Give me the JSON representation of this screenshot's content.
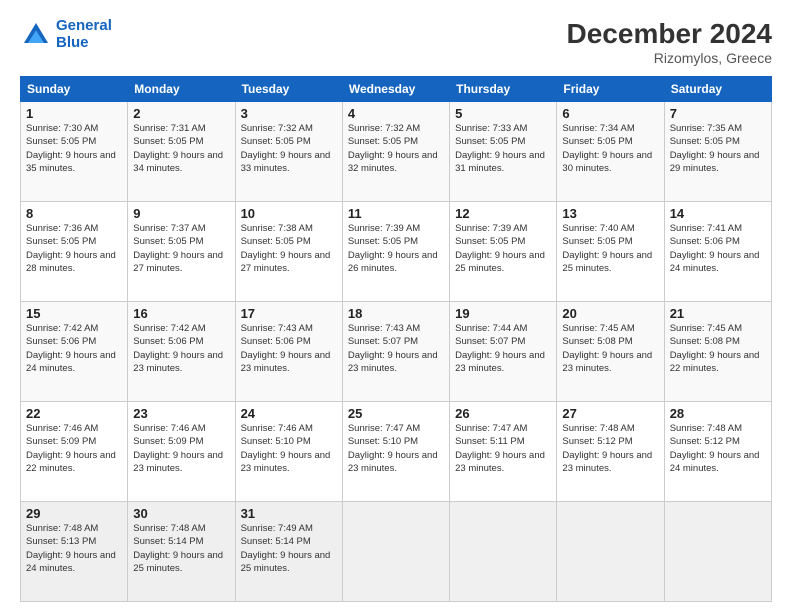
{
  "logo": {
    "line1": "General",
    "line2": "Blue"
  },
  "title": "December 2024",
  "subtitle": "Rizomylos, Greece",
  "weekdays": [
    "Sunday",
    "Monday",
    "Tuesday",
    "Wednesday",
    "Thursday",
    "Friday",
    "Saturday"
  ],
  "weeks": [
    [
      {
        "day": "1",
        "sunrise": "7:30 AM",
        "sunset": "5:05 PM",
        "daylight": "9 hours and 35 minutes."
      },
      {
        "day": "2",
        "sunrise": "7:31 AM",
        "sunset": "5:05 PM",
        "daylight": "9 hours and 34 minutes."
      },
      {
        "day": "3",
        "sunrise": "7:32 AM",
        "sunset": "5:05 PM",
        "daylight": "9 hours and 33 minutes."
      },
      {
        "day": "4",
        "sunrise": "7:32 AM",
        "sunset": "5:05 PM",
        "daylight": "9 hours and 32 minutes."
      },
      {
        "day": "5",
        "sunrise": "7:33 AM",
        "sunset": "5:05 PM",
        "daylight": "9 hours and 31 minutes."
      },
      {
        "day": "6",
        "sunrise": "7:34 AM",
        "sunset": "5:05 PM",
        "daylight": "9 hours and 30 minutes."
      },
      {
        "day": "7",
        "sunrise": "7:35 AM",
        "sunset": "5:05 PM",
        "daylight": "9 hours and 29 minutes."
      }
    ],
    [
      {
        "day": "8",
        "sunrise": "7:36 AM",
        "sunset": "5:05 PM",
        "daylight": "9 hours and 28 minutes."
      },
      {
        "day": "9",
        "sunrise": "7:37 AM",
        "sunset": "5:05 PM",
        "daylight": "9 hours and 27 minutes."
      },
      {
        "day": "10",
        "sunrise": "7:38 AM",
        "sunset": "5:05 PM",
        "daylight": "9 hours and 27 minutes."
      },
      {
        "day": "11",
        "sunrise": "7:39 AM",
        "sunset": "5:05 PM",
        "daylight": "9 hours and 26 minutes."
      },
      {
        "day": "12",
        "sunrise": "7:39 AM",
        "sunset": "5:05 PM",
        "daylight": "9 hours and 25 minutes."
      },
      {
        "day": "13",
        "sunrise": "7:40 AM",
        "sunset": "5:05 PM",
        "daylight": "9 hours and 25 minutes."
      },
      {
        "day": "14",
        "sunrise": "7:41 AM",
        "sunset": "5:06 PM",
        "daylight": "9 hours and 24 minutes."
      }
    ],
    [
      {
        "day": "15",
        "sunrise": "7:42 AM",
        "sunset": "5:06 PM",
        "daylight": "9 hours and 24 minutes."
      },
      {
        "day": "16",
        "sunrise": "7:42 AM",
        "sunset": "5:06 PM",
        "daylight": "9 hours and 23 minutes."
      },
      {
        "day": "17",
        "sunrise": "7:43 AM",
        "sunset": "5:06 PM",
        "daylight": "9 hours and 23 minutes."
      },
      {
        "day": "18",
        "sunrise": "7:43 AM",
        "sunset": "5:07 PM",
        "daylight": "9 hours and 23 minutes."
      },
      {
        "day": "19",
        "sunrise": "7:44 AM",
        "sunset": "5:07 PM",
        "daylight": "9 hours and 23 minutes."
      },
      {
        "day": "20",
        "sunrise": "7:45 AM",
        "sunset": "5:08 PM",
        "daylight": "9 hours and 23 minutes."
      },
      {
        "day": "21",
        "sunrise": "7:45 AM",
        "sunset": "5:08 PM",
        "daylight": "9 hours and 22 minutes."
      }
    ],
    [
      {
        "day": "22",
        "sunrise": "7:46 AM",
        "sunset": "5:09 PM",
        "daylight": "9 hours and 22 minutes."
      },
      {
        "day": "23",
        "sunrise": "7:46 AM",
        "sunset": "5:09 PM",
        "daylight": "9 hours and 23 minutes."
      },
      {
        "day": "24",
        "sunrise": "7:46 AM",
        "sunset": "5:10 PM",
        "daylight": "9 hours and 23 minutes."
      },
      {
        "day": "25",
        "sunrise": "7:47 AM",
        "sunset": "5:10 PM",
        "daylight": "9 hours and 23 minutes."
      },
      {
        "day": "26",
        "sunrise": "7:47 AM",
        "sunset": "5:11 PM",
        "daylight": "9 hours and 23 minutes."
      },
      {
        "day": "27",
        "sunrise": "7:48 AM",
        "sunset": "5:12 PM",
        "daylight": "9 hours and 23 minutes."
      },
      {
        "day": "28",
        "sunrise": "7:48 AM",
        "sunset": "5:12 PM",
        "daylight": "9 hours and 24 minutes."
      }
    ],
    [
      {
        "day": "29",
        "sunrise": "7:48 AM",
        "sunset": "5:13 PM",
        "daylight": "9 hours and 24 minutes."
      },
      {
        "day": "30",
        "sunrise": "7:48 AM",
        "sunset": "5:14 PM",
        "daylight": "9 hours and 25 minutes."
      },
      {
        "day": "31",
        "sunrise": "7:49 AM",
        "sunset": "5:14 PM",
        "daylight": "9 hours and 25 minutes."
      },
      null,
      null,
      null,
      null
    ]
  ]
}
